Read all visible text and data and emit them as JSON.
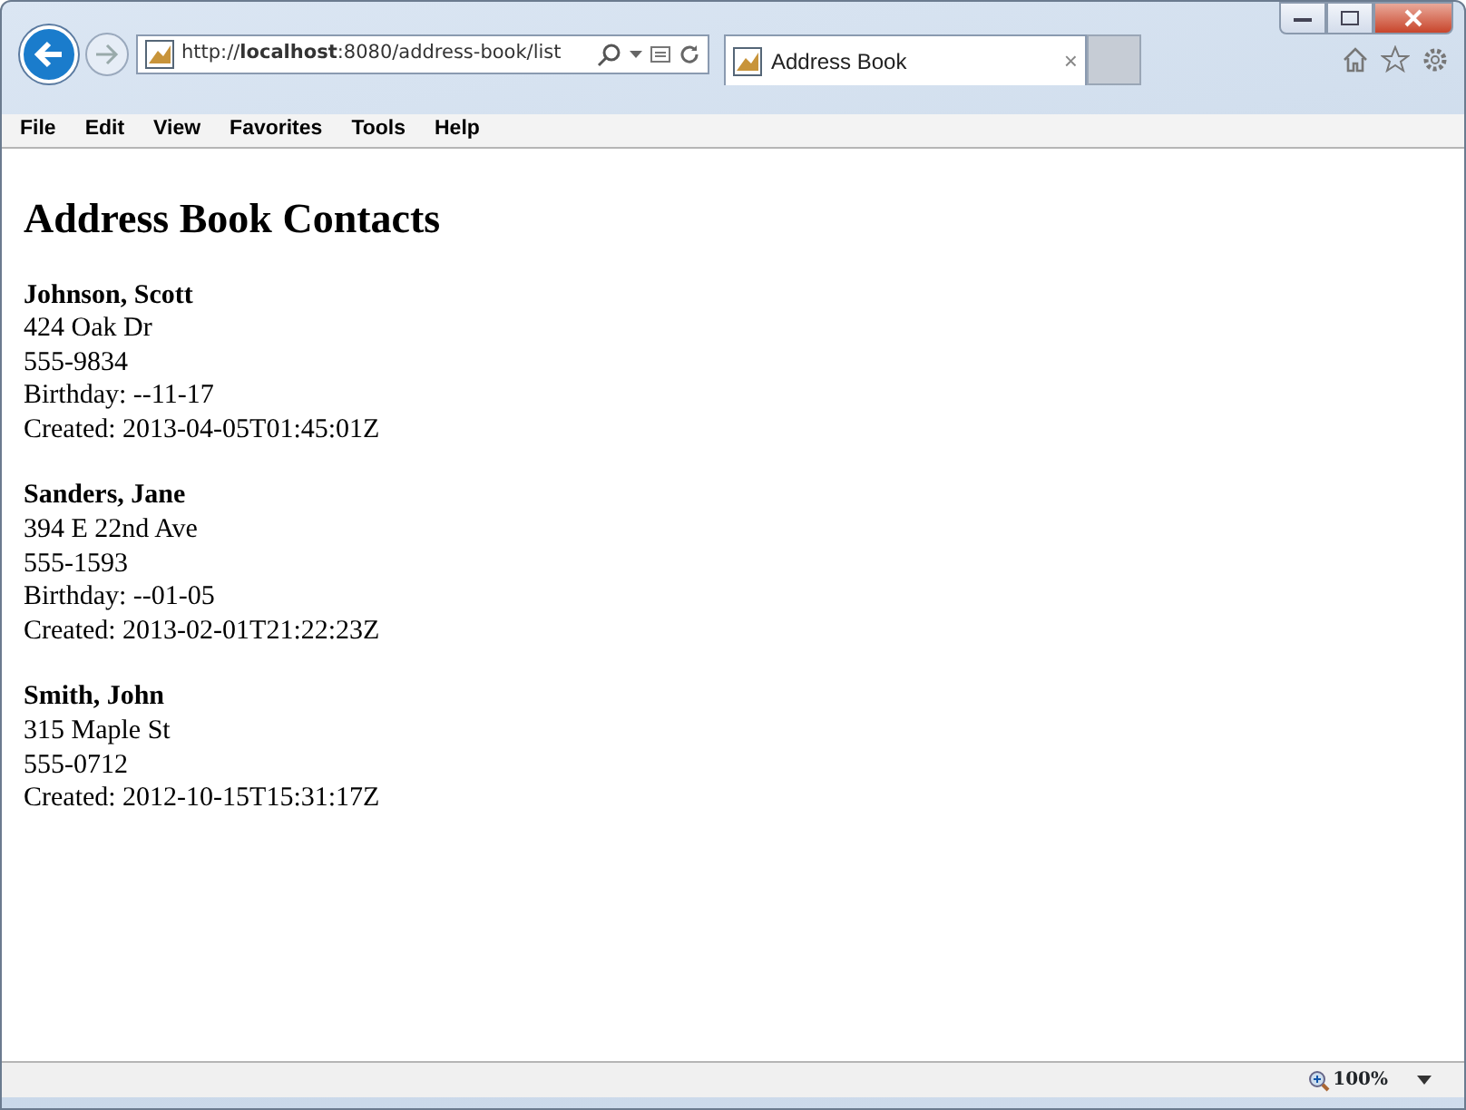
{
  "browser": {
    "address": "http://**localhost**:8080/address-book/list",
    "tab": {
      "title": "Address Book",
      "close": "×",
      "selected": true
    },
    "menu": [
      "File",
      "Edit",
      "View",
      "Favorites",
      "Tools",
      "Help"
    ],
    "zoom": "100%"
  },
  "page": {
    "heading": "Address Book Contacts",
    "contacts": [
      {
        "name": "Johnson, Scott",
        "lines": [
          "424 Oak Dr",
          "555-9834",
          "Birthday: --11-17",
          "Created: 2013-04-05T01:45:01Z"
        ]
      },
      {
        "name": "Sanders, Jane",
        "lines": [
          "394 E 22nd Ave",
          "555-1593",
          "Birthday: --01-05",
          "Created: 2013-02-01T21:22:23Z"
        ]
      },
      {
        "name": "Smith, John",
        "lines": [
          "315 Maple St",
          "555-0712",
          "Created: 2012-10-15T15:31:17Z"
        ]
      }
    ]
  }
}
